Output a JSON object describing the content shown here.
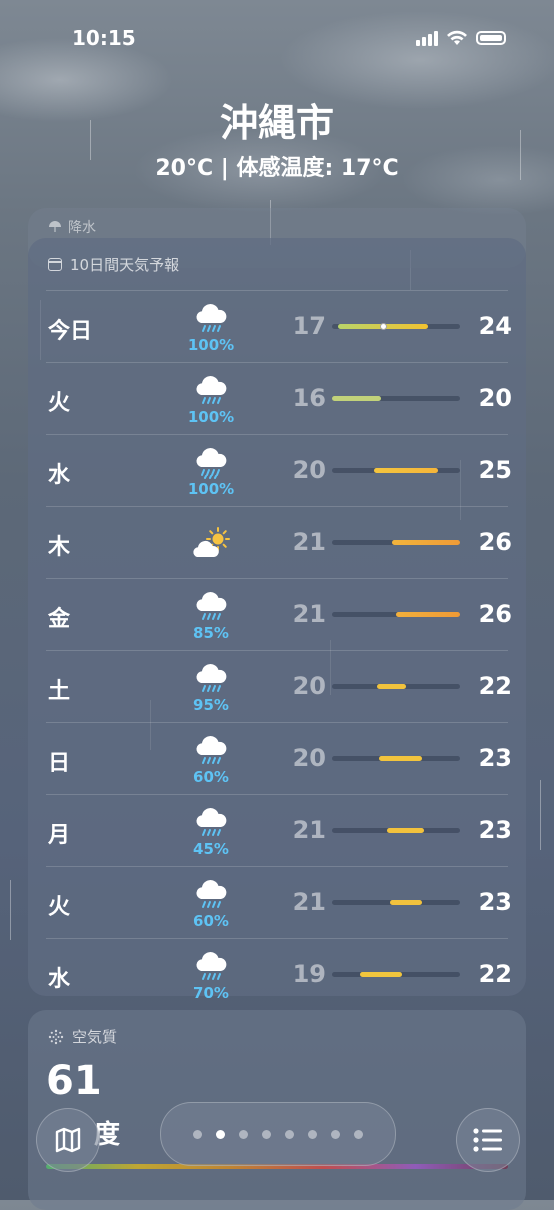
{
  "status_bar": {
    "time": "10:15"
  },
  "location": {
    "city": "沖縄市",
    "subtitle": "20°C | 体感温度: 17°C"
  },
  "background_card": {
    "label": "降水"
  },
  "forecast": {
    "header": "10日間天気予報",
    "days": [
      {
        "day": "今日",
        "icon": "cloud-rain-icon",
        "precip": "100%",
        "low": "17",
        "high": "24",
        "range_start": 0.05,
        "range_end": 0.75,
        "current_marker": 0.4,
        "color_start": "#b9d46a",
        "color_end": "#f2c230"
      },
      {
        "day": "火",
        "icon": "cloud-rain-icon",
        "precip": "100%",
        "low": "16",
        "high": "20",
        "range_start": 0.0,
        "range_end": 0.38,
        "color_start": "#c2d27a",
        "color_end": "#c2d27a"
      },
      {
        "day": "水",
        "icon": "cloud-heavy-rain-icon",
        "precip": "100%",
        "low": "20",
        "high": "25",
        "range_start": 0.33,
        "range_end": 0.83,
        "color_start": "#f4c53e",
        "color_end": "#f5b53a"
      },
      {
        "day": "木",
        "icon": "partly-sunny-icon",
        "precip": "",
        "low": "21",
        "high": "26",
        "range_start": 0.47,
        "range_end": 1.0,
        "color_start": "#f2b43c",
        "color_end": "#ef9b37"
      },
      {
        "day": "金",
        "icon": "cloud-rain-icon",
        "precip": "85%",
        "low": "21",
        "high": "26",
        "range_start": 0.5,
        "range_end": 1.0,
        "color_start": "#f3b03c",
        "color_end": "#ef9a36"
      },
      {
        "day": "土",
        "icon": "cloud-rain-icon",
        "precip": "95%",
        "low": "20",
        "high": "22",
        "range_start": 0.35,
        "range_end": 0.58,
        "color_start": "#f2c33d",
        "color_end": "#f2c33d"
      },
      {
        "day": "日",
        "icon": "cloud-rain-icon",
        "precip": "60%",
        "low": "20",
        "high": "23",
        "range_start": 0.37,
        "range_end": 0.7,
        "color_start": "#f2c43d",
        "color_end": "#f2c43d"
      },
      {
        "day": "月",
        "icon": "cloud-rain-icon",
        "precip": "45%",
        "low": "21",
        "high": "23",
        "range_start": 0.43,
        "range_end": 0.72,
        "color_start": "#f2c23d",
        "color_end": "#f2c23d"
      },
      {
        "day": "火",
        "icon": "cloud-rain-icon",
        "precip": "60%",
        "low": "21",
        "high": "23",
        "range_start": 0.45,
        "range_end": 0.7,
        "color_start": "#f2c23d",
        "color_end": "#f2c23d"
      },
      {
        "day": "水",
        "icon": "cloud-rain-icon",
        "precip": "70%",
        "low": "19",
        "high": "22",
        "range_start": 0.22,
        "range_end": 0.55,
        "color_start": "#f2c63d",
        "color_end": "#f2c63d"
      }
    ]
  },
  "air_quality": {
    "label": "空気質",
    "value": "61",
    "category": "度"
  },
  "pager": {
    "count": 8,
    "active": 1
  },
  "colors": {
    "precip": "#5ec3f4",
    "sun": "#f6c342"
  }
}
